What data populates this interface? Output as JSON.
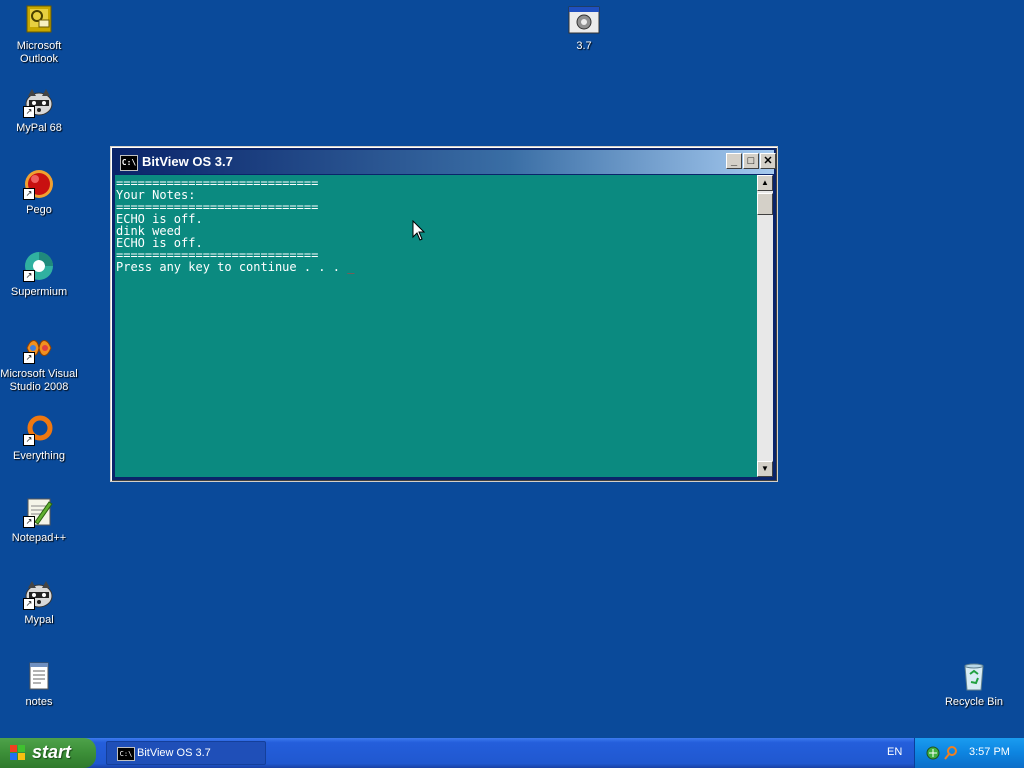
{
  "desktop": {
    "icons": [
      {
        "label": "Microsoft Outlook",
        "icon": "outlook-icon"
      },
      {
        "label": "MyPal 68",
        "icon": "raccoon-icon"
      },
      {
        "label": "Pego",
        "icon": "red-ball-icon"
      },
      {
        "label": "Supermium",
        "icon": "browser-icon"
      },
      {
        "label": "Microsoft Visual Studio 2008",
        "icon": "visual-studio-icon"
      },
      {
        "label": "Everything",
        "icon": "search-ring-icon"
      },
      {
        "label": "Notepad++",
        "icon": "notepadpp-icon"
      },
      {
        "label": "Mypal",
        "icon": "raccoon-icon"
      },
      {
        "label": "notes",
        "icon": "text-file-icon"
      },
      {
        "label": "3.7",
        "icon": "batch-file-icon"
      },
      {
        "label": "Recycle Bin",
        "icon": "recycle-bin-icon"
      }
    ],
    "background_color": "#0a4a9a"
  },
  "window": {
    "title": "BitView OS 3.7",
    "title_icon_text": "C:\\",
    "minimize_label": "_",
    "maximize_label": "□",
    "close_label": "✕",
    "console_lines": [
      "============================",
      "Your Notes:",
      "============================",
      "ECHO is off.",
      "dink weed",
      "ECHO is off.",
      "============================",
      "Press any key to continue . . . "
    ],
    "cursor_glyph": "_",
    "console_bg": "#0b8a80"
  },
  "taskbar": {
    "start_label": "start",
    "task_item_label": "BitView OS 3.7",
    "language": "EN",
    "clock": "3:57 PM"
  }
}
